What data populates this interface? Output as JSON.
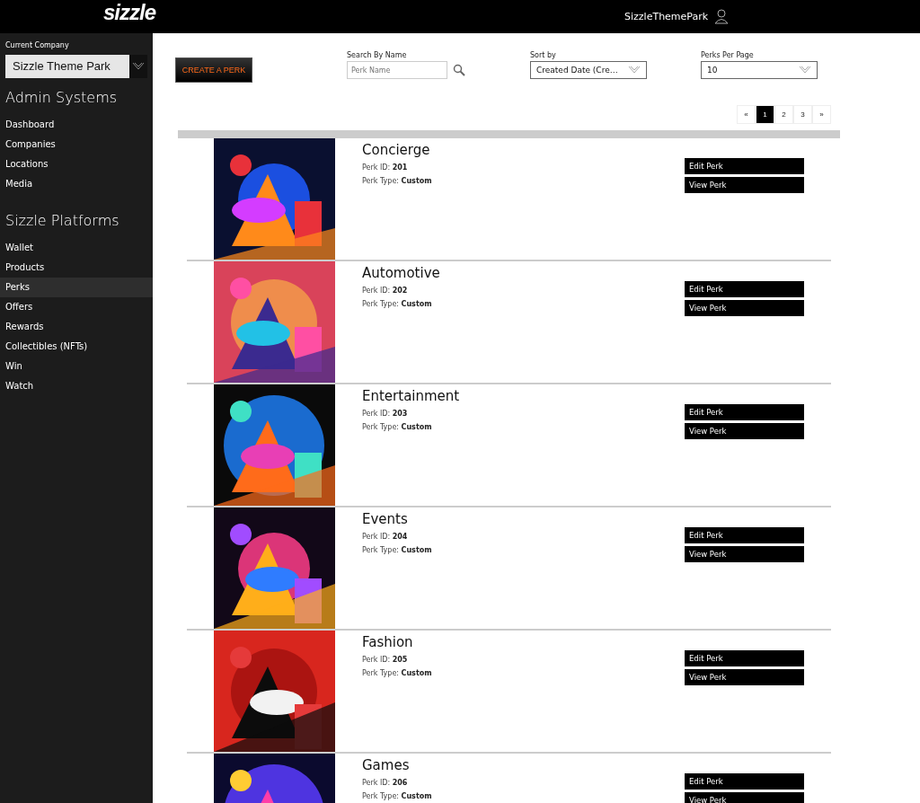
{
  "header": {
    "logo": "sizzle",
    "user": "SizzleThemePark"
  },
  "sidebar": {
    "company_label": "Current Company",
    "company": "Sizzle Theme Park",
    "sections": [
      {
        "title": "Admin Systems",
        "items": [
          {
            "label": "Dashboard",
            "selected": false
          },
          {
            "label": "Companies",
            "selected": false
          },
          {
            "label": "Locations",
            "selected": false
          },
          {
            "label": "Media",
            "selected": false
          }
        ]
      },
      {
        "title": "Sizzle Platforms",
        "items": [
          {
            "label": "Wallet",
            "selected": false
          },
          {
            "label": "Products",
            "selected": false
          },
          {
            "label": "Perks",
            "selected": true
          },
          {
            "label": "Offers",
            "selected": false
          },
          {
            "label": "Rewards",
            "selected": false
          },
          {
            "label": "Collectibles (NFTs)",
            "selected": false
          },
          {
            "label": "Win",
            "selected": false
          },
          {
            "label": "Watch",
            "selected": false
          }
        ]
      }
    ]
  },
  "toolbar": {
    "create_button": "CREATE A PERK",
    "search_label": "Search By Name",
    "search_placeholder": "Perk Name",
    "sort_label": "Sort by",
    "sort_value": "Created Date (Cre…",
    "per_page_label": "Perks Per Page",
    "per_page_value": "10"
  },
  "pagination": [
    {
      "label": "«",
      "selected": false
    },
    {
      "label": "1",
      "selected": true
    },
    {
      "label": "2",
      "selected": false
    },
    {
      "label": "3",
      "selected": false
    },
    {
      "label": "»",
      "selected": false
    }
  ],
  "perks": [
    {
      "name": "Concierge",
      "id_text": "Perk ID: **201**",
      "type_text": "Perk Type: **Custom**",
      "edit": "Edit Perk",
      "view": "View Perk"
    },
    {
      "name": "Automotive",
      "id_text": "Perk ID: **202**",
      "type_text": "Perk Type: **Custom**",
      "edit": "Edit Perk",
      "view": "View Perk"
    },
    {
      "name": "Entertainment",
      "id_text": "Perk ID: **203**",
      "type_text": "Perk Type: **Custom**",
      "edit": "Edit Perk",
      "view": "View Perk"
    },
    {
      "name": "Events",
      "id_text": "Perk ID: **204**",
      "type_text": "Perk Type: **Custom**",
      "edit": "Edit Perk",
      "view": "View Perk"
    },
    {
      "name": "Fashion",
      "id_text": "Perk ID: **205**",
      "type_text": "Perk Type: **Custom**",
      "edit": "Edit Perk",
      "view": "View Perk"
    },
    {
      "name": "Games",
      "id_text": "Perk ID: **206**",
      "type_text": "Perk Type: **Custom**",
      "edit": "Edit Perk",
      "view": "View Perk"
    }
  ]
}
